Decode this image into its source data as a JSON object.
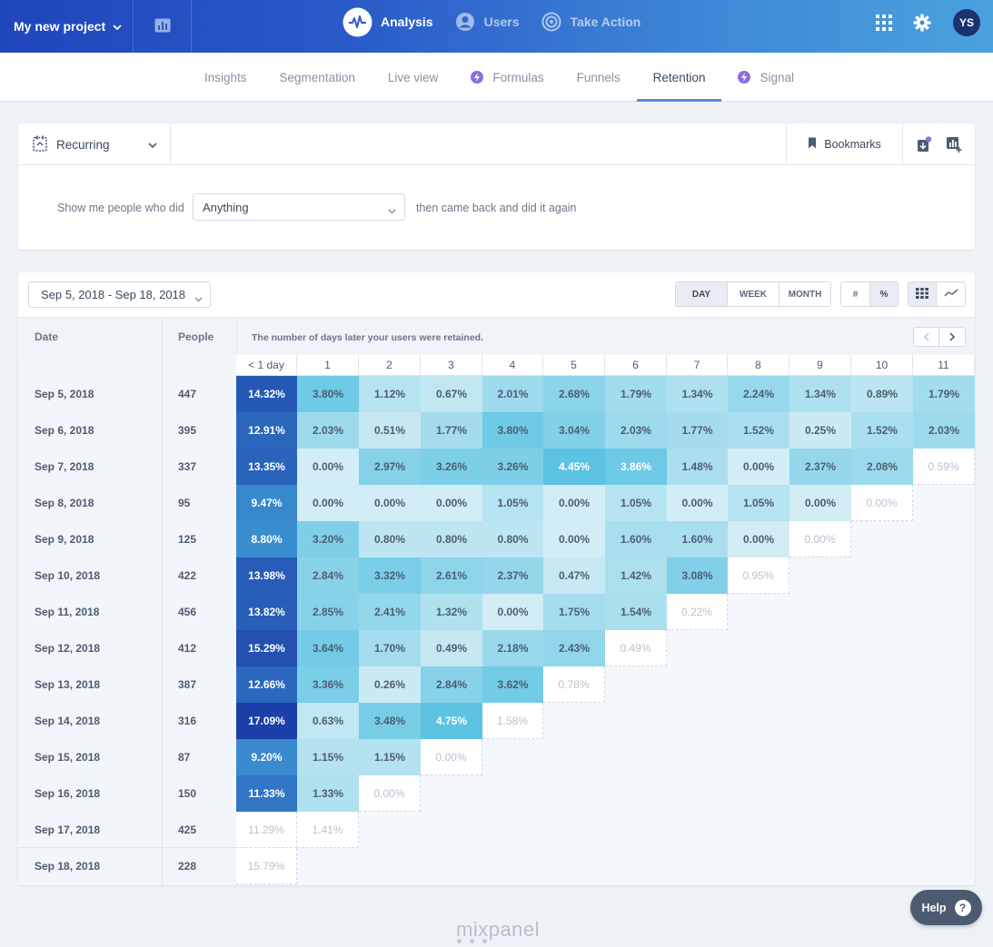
{
  "topbar": {
    "project": "My new project",
    "nav": [
      {
        "label": "Analysis",
        "icon": "pulse-icon",
        "active": true
      },
      {
        "label": "Users",
        "icon": "user-icon",
        "active": false
      },
      {
        "label": "Take Action",
        "icon": "target-icon",
        "active": false
      }
    ],
    "avatar": "YS"
  },
  "subnav": {
    "tabs": [
      {
        "label": "Insights",
        "bolt": false,
        "active": false
      },
      {
        "label": "Segmentation",
        "bolt": false,
        "active": false
      },
      {
        "label": "Live view",
        "bolt": false,
        "active": false
      },
      {
        "label": "Formulas",
        "bolt": true,
        "active": false
      },
      {
        "label": "Funnels",
        "bolt": false,
        "active": false
      },
      {
        "label": "Retention",
        "bolt": false,
        "active": true
      },
      {
        "label": "Signal",
        "bolt": true,
        "active": false
      }
    ]
  },
  "query": {
    "type": "Recurring",
    "bookmarks": "Bookmarks",
    "show_label": "Show me people who did",
    "event": "Anything",
    "then_label": "then came back and did it again"
  },
  "results": {
    "date_range": "Sep 5, 2018 - Sep 18, 2018",
    "units": [
      "DAY",
      "WEEK",
      "MONTH"
    ],
    "active_unit": "DAY",
    "formats": [
      "#",
      "%"
    ],
    "active_format": "%",
    "header": {
      "date": "Date",
      "people": "People",
      "description": "The number of days later your users were retained."
    },
    "columns": [
      "< 1 day",
      "1",
      "2",
      "3",
      "4",
      "5",
      "6",
      "7",
      "8",
      "9",
      "10",
      "11"
    ],
    "rows": [
      {
        "date": "Sep 5, 2018",
        "people": "447",
        "values": [
          "14.32%",
          "3.80%",
          "1.12%",
          "0.67%",
          "2.01%",
          "2.68%",
          "1.79%",
          "1.34%",
          "2.24%",
          "1.34%",
          "0.89%",
          "1.79%"
        ],
        "complete": 12
      },
      {
        "date": "Sep 6, 2018",
        "people": "395",
        "values": [
          "12.91%",
          "2.03%",
          "0.51%",
          "1.77%",
          "3.80%",
          "3.04%",
          "2.03%",
          "1.77%",
          "1.52%",
          "0.25%",
          "1.52%",
          "2.03%"
        ],
        "complete": 11
      },
      {
        "date": "Sep 7, 2018",
        "people": "337",
        "values": [
          "13.35%",
          "0.00%",
          "2.97%",
          "3.26%",
          "3.26%",
          "4.45%",
          "3.86%",
          "1.48%",
          "0.00%",
          "2.37%",
          "2.08%",
          "0.59%"
        ],
        "complete": 10
      },
      {
        "date": "Sep 8, 2018",
        "people": "95",
        "values": [
          "9.47%",
          "0.00%",
          "0.00%",
          "0.00%",
          "1.05%",
          "0.00%",
          "1.05%",
          "0.00%",
          "1.05%",
          "0.00%",
          "0.00%"
        ],
        "complete": 9
      },
      {
        "date": "Sep 9, 2018",
        "people": "125",
        "values": [
          "8.80%",
          "3.20%",
          "0.80%",
          "0.80%",
          "0.80%",
          "0.00%",
          "1.60%",
          "1.60%",
          "0.00%",
          "0.00%"
        ],
        "complete": 8
      },
      {
        "date": "Sep 10, 2018",
        "people": "422",
        "values": [
          "13.98%",
          "2.84%",
          "3.32%",
          "2.61%",
          "2.37%",
          "0.47%",
          "1.42%",
          "3.08%",
          "0.95%"
        ],
        "complete": 7
      },
      {
        "date": "Sep 11, 2018",
        "people": "456",
        "values": [
          "13.82%",
          "2.85%",
          "2.41%",
          "1.32%",
          "0.00%",
          "1.75%",
          "1.54%",
          "0.22%"
        ],
        "complete": 6
      },
      {
        "date": "Sep 12, 2018",
        "people": "412",
        "values": [
          "15.29%",
          "3.64%",
          "1.70%",
          "0.49%",
          "2.18%",
          "2.43%",
          "0.49%"
        ],
        "complete": 5
      },
      {
        "date": "Sep 13, 2018",
        "people": "387",
        "values": [
          "12.66%",
          "3.36%",
          "0.26%",
          "2.84%",
          "3.62%",
          "0.78%"
        ],
        "complete": 4
      },
      {
        "date": "Sep 14, 2018",
        "people": "316",
        "values": [
          "17.09%",
          "0.63%",
          "3.48%",
          "4.75%",
          "1.58%"
        ],
        "complete": 3
      },
      {
        "date": "Sep 15, 2018",
        "people": "87",
        "values": [
          "9.20%",
          "1.15%",
          "1.15%",
          "0.00%"
        ],
        "complete": 2
      },
      {
        "date": "Sep 16, 2018",
        "people": "150",
        "values": [
          "11.33%",
          "1.33%",
          "0.00%"
        ],
        "complete": 1
      },
      {
        "date": "Sep 17, 2018",
        "people": "425",
        "values": [
          "11.29%",
          "1.41%"
        ],
        "complete": 0
      },
      {
        "date": "Sep 18, 2018",
        "people": "228",
        "values": [
          "15.79%"
        ],
        "complete": 0
      }
    ]
  },
  "help": "Help",
  "brand": "mixpanel",
  "colors": {
    "first_col_dark": "#1c3fa9",
    "first_col_light": "#3a8ed0",
    "cell_light": "#d2edf5",
    "cell_dark": "#5cc3e2",
    "incomplete_text": "#b9c2cf"
  }
}
